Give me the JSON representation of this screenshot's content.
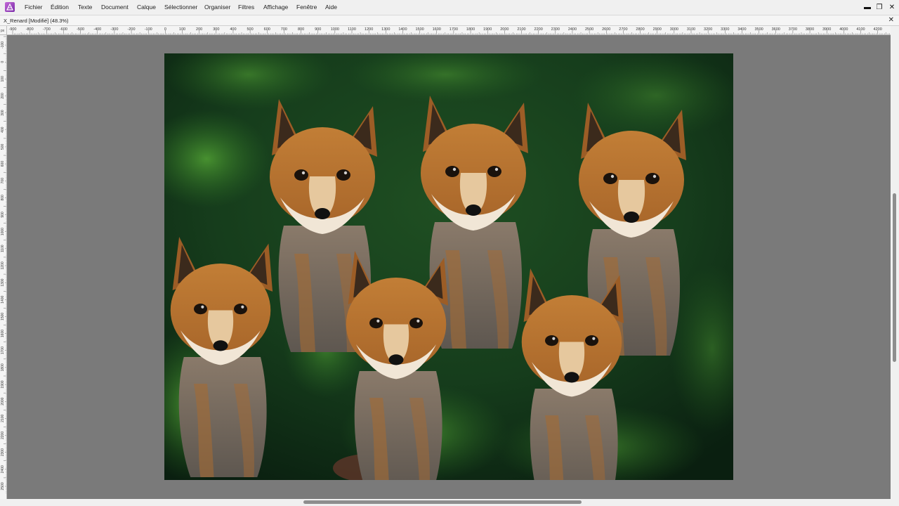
{
  "app": {
    "logo": "affinity-photo-icon"
  },
  "menu": {
    "items": [
      "Fichier",
      "Édition",
      "Texte",
      "Document",
      "Calque",
      "Sélectionner",
      "Organiser",
      "Filtres",
      "Affichage",
      "Fenêtre",
      "Aide"
    ]
  },
  "window_controls": {
    "minimize": "▬",
    "restore": "❐",
    "close": "✕"
  },
  "document": {
    "title": "X_Renard [Modifié] (48.3%)",
    "close_label": "✕"
  },
  "rulers": {
    "unit": "px",
    "horizontal_labels": [
      "-900",
      "-800",
      "-700",
      "-600",
      "-500",
      "-400",
      "-300",
      "-200",
      "-100",
      "0",
      "100",
      "200",
      "300",
      "400",
      "500",
      "600",
      "700",
      "800",
      "900",
      "1000",
      "1100",
      "1200",
      "1300",
      "1400",
      "1500",
      "1600",
      "1700",
      "1800",
      "1900",
      "2000",
      "2100",
      "2200",
      "2300",
      "2400",
      "2500",
      "2600",
      "2700",
      "2800",
      "2900",
      "3000",
      "3100",
      "3200",
      "3300",
      "3400",
      "3500",
      "3600",
      "3700",
      "3800",
      "3900",
      "4000",
      "4100",
      "4200"
    ],
    "vertical_labels": [
      "-100",
      "0",
      "100",
      "200",
      "300",
      "400",
      "500",
      "600",
      "700",
      "800",
      "900",
      "1000",
      "1100",
      "1200",
      "1300",
      "1400",
      "1500",
      "1600",
      "1700",
      "1800",
      "1900",
      "2000",
      "2100",
      "2200",
      "2300",
      "2400",
      "2500"
    ]
  },
  "image": {
    "description_icon": "fox-cubs-photo",
    "colors": {
      "bg_dark": "#0e2a14",
      "bg_green": "#2f6b26",
      "fur": "#b8742e",
      "fur_light": "#e8cba3",
      "fur_gray": "#6e6660"
    }
  }
}
